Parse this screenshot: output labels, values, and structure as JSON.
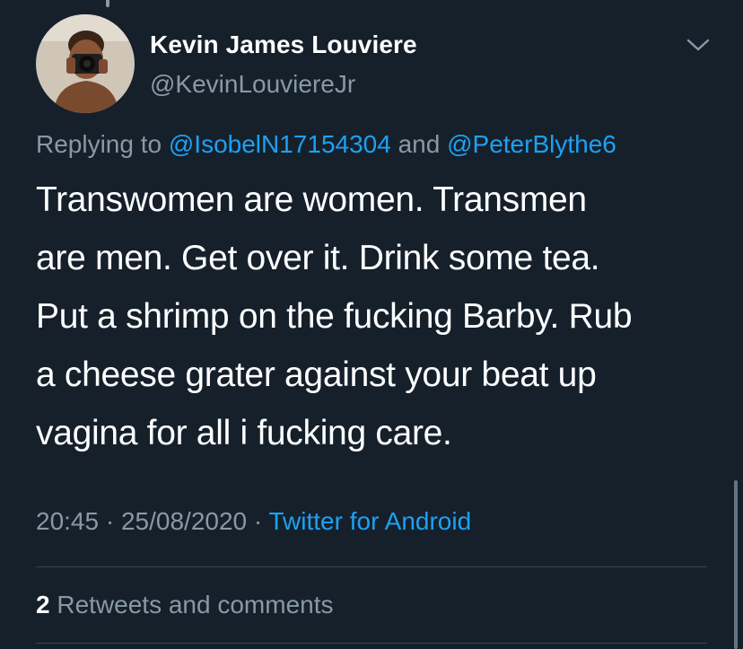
{
  "tweet": {
    "display_name": "Kevin James Louviere",
    "handle": "@KevinLouviereJr",
    "replying_prefix": "Replying to",
    "mention_1": "@IsobelN17154304",
    "replying_and": "and",
    "mention_2": "@PeterBlythe6",
    "text_lines": [
      "Transwomen are women. Transmen",
      "are men. Get over it. Drink some tea.",
      "Put a shrimp on the fucking Barby. Rub",
      "a cheese grater against your beat up",
      "vagina for all i fucking care."
    ],
    "time": "20:45",
    "separator": "·",
    "date": "25/08/2020",
    "source": "Twitter for Android",
    "retweet_count": "2",
    "retweet_label": "Retweets and comments"
  },
  "icons": {
    "avatar": "avatar",
    "menu": "chevron-down-icon"
  },
  "colors": {
    "background": "#15202b",
    "text_primary": "#ffffff",
    "text_secondary": "#8899a6",
    "accent": "#1da1f2",
    "divider": "#38444d"
  }
}
